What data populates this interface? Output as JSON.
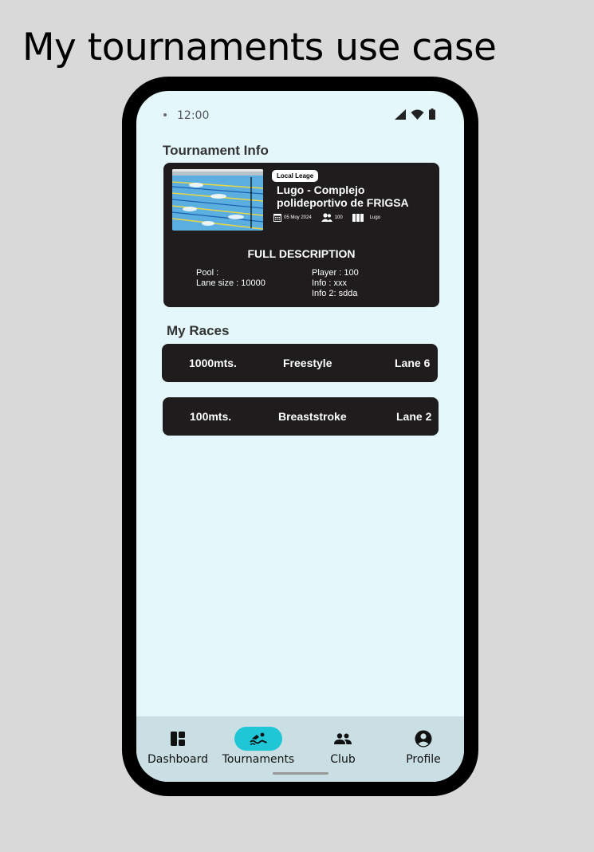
{
  "page_heading": "My tournaments use case",
  "status_bar": {
    "time": "12:00"
  },
  "tournament_info": {
    "title": "Tournament Info",
    "badge": "Local Leage",
    "venue_name": "Lugo - Complejo polideportivo de FRIGSA",
    "date": "05 Moy 2024",
    "players": "100",
    "location": "Lugo",
    "description_title": "FULL DESCRIPTION",
    "left_lines": [
      "Pool :",
      "Lane size : 10000"
    ],
    "right_lines": [
      "Player : 100",
      "Info : xxx",
      "Info 2: sdda"
    ]
  },
  "races": {
    "title": "My Races",
    "items": [
      {
        "distance": "1000mts.",
        "style": "Freestyle",
        "lane": "Lane 6"
      },
      {
        "distance": "100mts.",
        "style": "Breaststroke",
        "lane": "Lane 2"
      }
    ]
  },
  "bottom_nav": {
    "active": "Tournaments",
    "items": [
      {
        "label": "Dashboard",
        "icon": "dashboard-icon"
      },
      {
        "label": "Tournaments",
        "icon": "swimmer-icon"
      },
      {
        "label": "Club",
        "icon": "people-icon"
      },
      {
        "label": "Profile",
        "icon": "account-circle-icon"
      }
    ]
  },
  "colors": {
    "background": "#d9d9d9",
    "screen": "#e4f7fa",
    "card": "#1e1c1c",
    "nav": "#c9dfe3",
    "accent": "#1fc6d6"
  }
}
